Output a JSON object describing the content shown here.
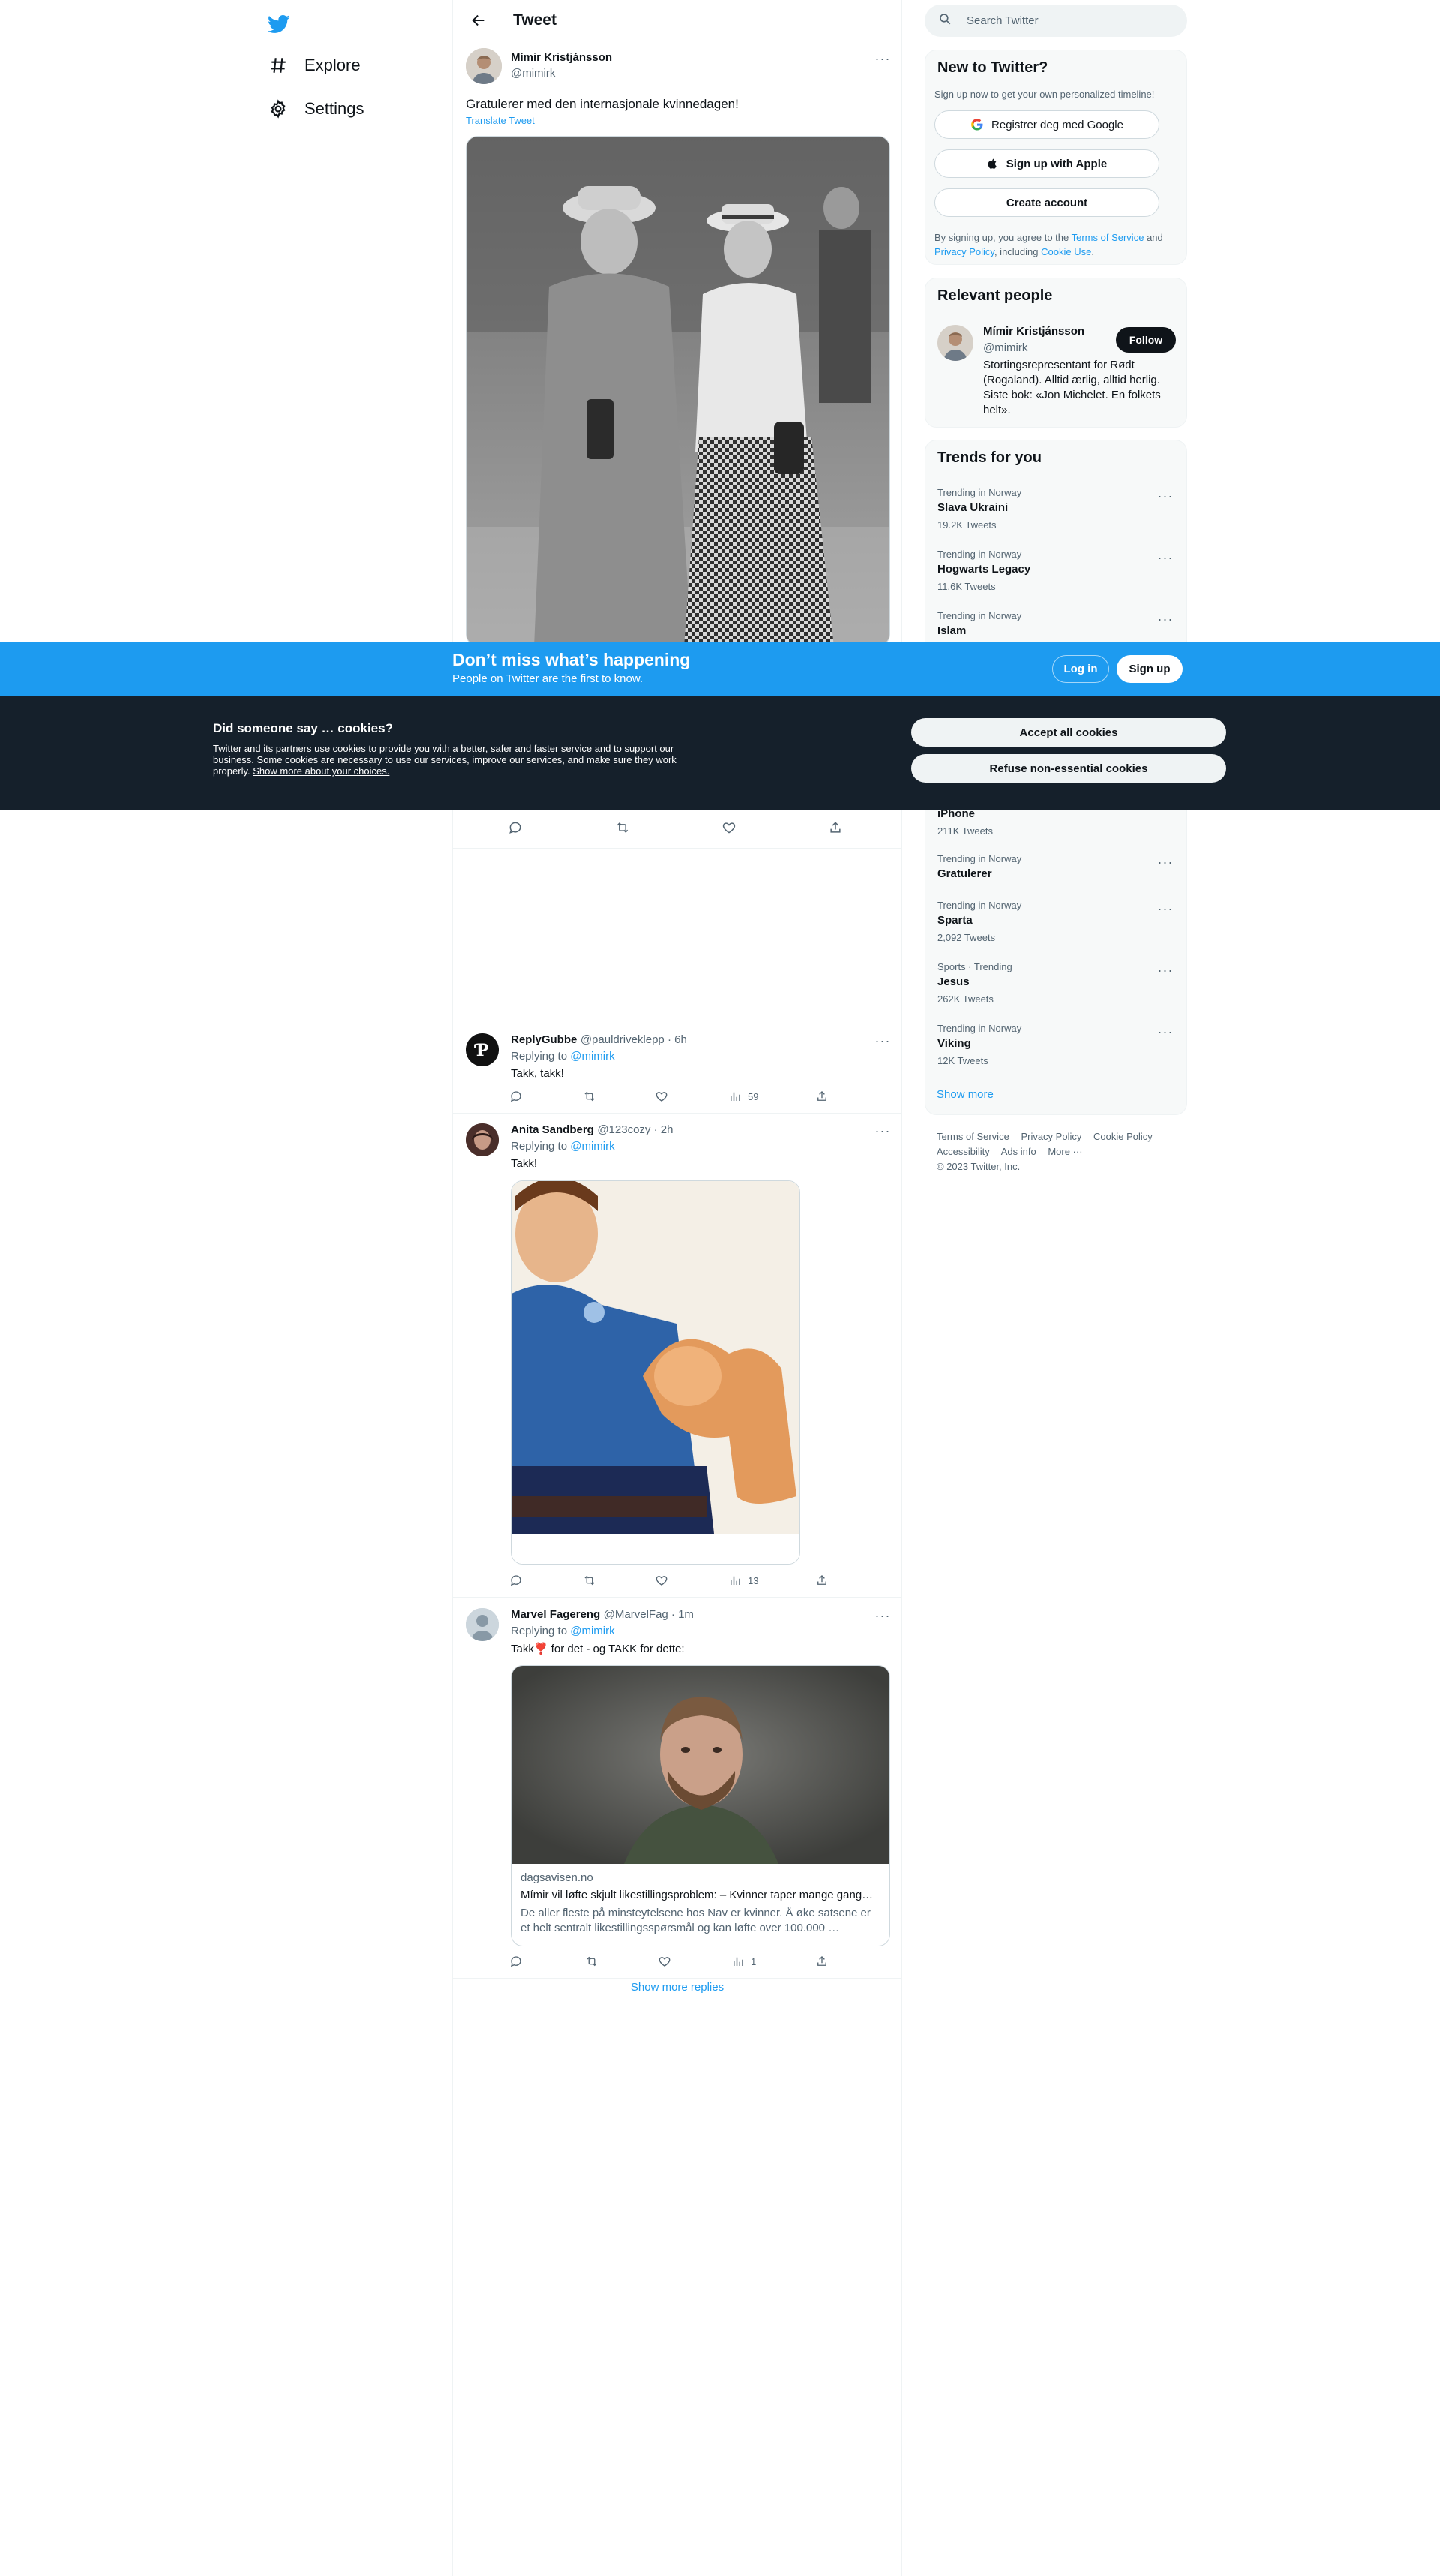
{
  "nav": {
    "logo": "twitter-bird-icon",
    "items": [
      {
        "label": "Explore",
        "icon": "hashtag-icon"
      },
      {
        "label": "Settings",
        "icon": "gear-icon"
      }
    ]
  },
  "header": {
    "title": "Tweet"
  },
  "focal_tweet": {
    "author_name": "Mímir Kristjánsson",
    "author_handle": "@mimirk",
    "text": "Gratulerer med den internasjonale kvinnedagen!",
    "translate_label": "Translate Tweet"
  },
  "replies": [
    {
      "name": "ReplyGubbe",
      "meta": "@pauldriveklepp · 6h",
      "replying_prefix": "Replying to",
      "replying_to": "@mimirk",
      "text": "Takk, takk!",
      "views": "59"
    },
    {
      "name": "Anita Sandberg",
      "meta": "@123cozy · 2h",
      "replying_prefix": "Replying to",
      "replying_to": "@mimirk",
      "text": "Takk!",
      "views": "13"
    },
    {
      "name": "Marvel Fagereng",
      "meta": "@MarvelFag · 1m",
      "replying_prefix": "Replying to",
      "replying_to": "@mimirk",
      "text": "Takk❣️ for det - og TAKK for dette:",
      "views": "1",
      "card": {
        "domain": "dagsavisen.no",
        "title": "Mímir vil løfte skjult likestillingsproblem: – Kvinner taper mange gang…",
        "description": "De aller fleste på minsteytelsene hos Nav er kvinner. Å øke satsene er et helt sentralt likestillingsspørsmål og kan løfte over 100.000 …"
      }
    }
  ],
  "show_more_replies": "Show more replies",
  "sidebar": {
    "search_placeholder": "Search Twitter",
    "new_to_twitter": {
      "title": "New to Twitter?",
      "subtitle": "Sign up now to get your own personalized timeline!",
      "google_button": "Registrer deg med Google",
      "apple_button": "Sign up with Apple",
      "create_button": "Create account",
      "legal_prefix": "By signing up, you agree to the",
      "terms_link": "Terms of Service",
      "legal_and": "and",
      "privacy_link": "Privacy Policy",
      "legal_including": ", including",
      "cookie_link": "Cookie Use",
      "legal_end": "."
    },
    "relevant_people": {
      "title": "Relevant people",
      "name": "Mímir Kristjánsson",
      "handle": "@mimirk",
      "bio": "Stortingsrepresentant for Rødt (Rogaland). Alltid ærlig, alltid herlig. Siste bok: «Jon Michelet. En folkets helt».",
      "follow_label": "Follow"
    },
    "trends": {
      "title": "Trends for you",
      "items": [
        {
          "context": "Trending in Norway",
          "name": "Slava Ukraini",
          "count": "19.2K Tweets"
        },
        {
          "context": "Trending in Norway",
          "name": "Hogwarts Legacy",
          "count": "11.6K Tweets"
        },
        {
          "context": "Trending in Norway",
          "name": "Islam",
          "count": ""
        },
        {
          "context": "",
          "name": "iPhone",
          "count": "211K Tweets"
        },
        {
          "context": "Trending in Norway",
          "name": "Gratulerer",
          "count": ""
        },
        {
          "context": "Trending in Norway",
          "name": "Sparta",
          "count": "2,092 Tweets"
        },
        {
          "context": "Sports · Trending",
          "name": "Jesus",
          "count": "262K Tweets"
        },
        {
          "context": "Trending in Norway",
          "name": "Viking",
          "count": "12K Tweets"
        }
      ],
      "show_more": "Show more"
    },
    "footer": {
      "links": [
        "Terms of Service",
        "Privacy Policy",
        "Cookie Policy",
        "Accessibility",
        "Ads info",
        "More ···"
      ],
      "copyright": "© 2023 Twitter, Inc."
    }
  },
  "bottom_bar": {
    "title": "Don’t miss what’s happening",
    "subtitle": "People on Twitter are the first to know.",
    "login": "Log in",
    "signup": "Sign up"
  },
  "cookie_banner": {
    "title": "Did someone say … cookies?",
    "body": "Twitter and its partners use cookies to provide you with a better, safer and faster service and to support our business. Some cookies are necessary to use our services, improve our services, and make sure they work properly.",
    "link": "Show more about your choices.",
    "accept": "Accept all cookies",
    "refuse": "Refuse non-essential cookies"
  },
  "colors": {
    "accent": "#1d9bf0",
    "text": "#0f1419",
    "muted": "#536471",
    "banner_dark": "#15202b"
  }
}
